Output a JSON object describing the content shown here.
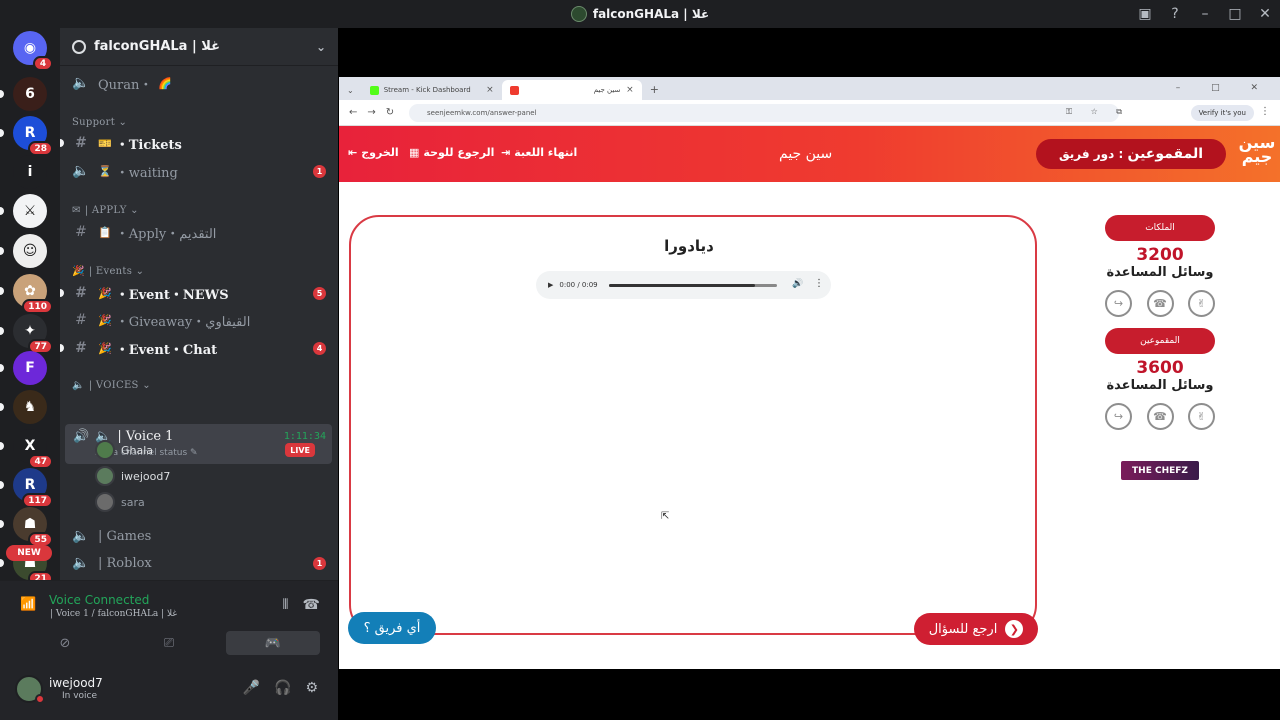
{
  "window": {
    "title": "falconGHALa | غلا"
  },
  "server": {
    "name": "falconGHALa | غلا"
  },
  "guilds": [
    {
      "label": "",
      "badge": "4",
      "color": "#5865f2",
      "icon": "discord-icon"
    },
    {
      "label": "6",
      "badge": "",
      "color": "#3a1f1a"
    },
    {
      "label": "R",
      "badge": "28",
      "color": "#1d4ed8"
    },
    {
      "label": "i",
      "badge": "",
      "color": "#1e1f22"
    },
    {
      "label": "⚔",
      "badge": "",
      "color": "#f2f3f5"
    },
    {
      "label": "☺",
      "badge": "",
      "color": "#eeeeee"
    },
    {
      "label": "✿",
      "badge": "110",
      "color": "#c9a27a"
    },
    {
      "label": "✦",
      "badge": "77",
      "color": "#2b2d31"
    },
    {
      "label": "F",
      "badge": "",
      "color": "#6d28d9"
    },
    {
      "label": "♞",
      "badge": "",
      "color": "#3a2a1a"
    },
    {
      "label": "X",
      "badge": "47",
      "color": "#1e1f22"
    },
    {
      "label": "R",
      "badge": "117",
      "color": "#1e3a8a"
    },
    {
      "label": "☗",
      "badge": "55",
      "color": "#4a3b2e"
    },
    {
      "label": "☗",
      "badge": "21",
      "color": "#3b4a2e"
    }
  ],
  "new_pill": "NEW",
  "channels": {
    "quran": {
      "label": "Quran・"
    },
    "support_cat": "Support",
    "tickets": {
      "label": "・Tickets"
    },
    "waiting": {
      "label": "・waiting",
      "badge": "1"
    },
    "apply_cat": "| APPLY",
    "apply": {
      "label": "・Apply・التقديم"
    },
    "events_cat": "| Events",
    "event_news": {
      "label": "・Event・NEWS",
      "badge": "5"
    },
    "giveaway": {
      "label": "・Giveaway・القيفاوي"
    },
    "event_chat": {
      "label": "・Event・Chat",
      "badge": "4"
    },
    "voices_cat": "| VOICES",
    "voice1": {
      "label": "| Voice 1",
      "time": "1:11:34",
      "status": "Set a channel status"
    },
    "voice_users": [
      {
        "name": "Ghala",
        "live": "LIVE",
        "color": "#4f7b4b"
      },
      {
        "name": "iwejood7",
        "live": "",
        "color": "#5b7b5d"
      },
      {
        "name": "sara",
        "live": "",
        "color": "#6b6b6b"
      }
    ],
    "games": {
      "label": "| Games"
    },
    "roblox": {
      "label": "| Roblox",
      "badge": "1"
    }
  },
  "voice_panel": {
    "title": "Voice Connected",
    "subtitle": "| Voice 1 / falconGHALa | غلا"
  },
  "user": {
    "name": "iwejood7",
    "status": "In voice"
  },
  "browser": {
    "tabs": [
      {
        "label": "Stream - Kick Dashboard",
        "color": "#53fc18"
      },
      {
        "label": "سين جيم",
        "color": "#ef3b2f"
      }
    ],
    "url": "seenjeemkw.com/answer-panel",
    "verify": "Verify it's you"
  },
  "game": {
    "exit": "الخروج",
    "back_board": "الرجوع للوحة",
    "end_game": "انتهاء اللعبة",
    "title": "سين جيم",
    "turn_prefix": "دور فريق :",
    "turn_team": "المقموعين",
    "logo": "سين جيم",
    "word": "ديادورا",
    "audio_time": "0:00 / 0:09",
    "audio_progress": 0.87,
    "any_team": "أي فريق ؟",
    "back_question": "ارجع للسؤال",
    "teams": [
      {
        "name": "الملكات",
        "score": "3200",
        "aids_label": "وسائل المساعدة"
      },
      {
        "name": "المقموعين",
        "score": "3600",
        "aids_label": "وسائل المساعدة"
      }
    ],
    "sponsor": "THE CHEFZ"
  }
}
